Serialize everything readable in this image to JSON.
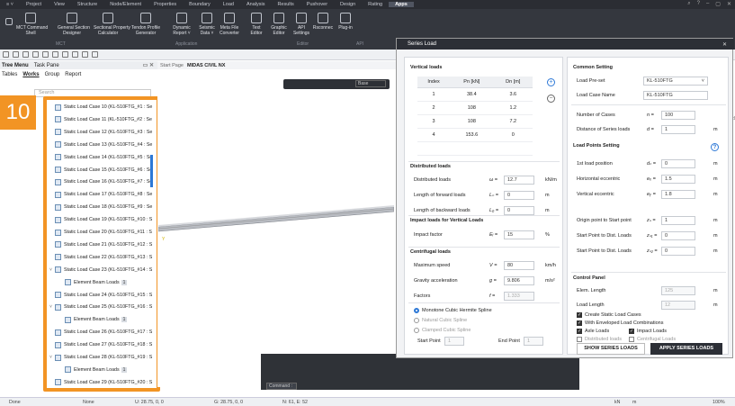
{
  "menubar": {
    "items": [
      "Project",
      "View",
      "Structure",
      "Node/Element",
      "Properties",
      "Boundary",
      "Load",
      "Analysis",
      "Results",
      "Pushover",
      "Design",
      "Rating",
      "Apps"
    ],
    "active": "Apps"
  },
  "ribbon": {
    "buttons": [
      {
        "label": "MCT Command\nShell"
      },
      {
        "label": "General Section\nDesigner"
      },
      {
        "label": "Sectional Property\nCalculator"
      },
      {
        "label": "Tendon Profile\nGenerator"
      },
      {
        "label": "Dynamic\nReport ˅"
      },
      {
        "label": "Seismic\nData ˅"
      },
      {
        "label": "Meta File\nConverter"
      },
      {
        "label": "Text\nEditor"
      },
      {
        "label": "Graphic\nEditor"
      },
      {
        "label": "API\nSettings"
      },
      {
        "label": "Rsconnec"
      },
      {
        "label": "Plug-in"
      }
    ],
    "groups": [
      "MCT",
      "Application",
      "Editor",
      "API"
    ]
  },
  "tree": {
    "header": [
      "Tree Menu",
      "Task Pane"
    ],
    "tabs": [
      "Tables",
      "Works",
      "Group",
      "Report"
    ],
    "active_tab": "Works",
    "search_placeholder": "Search",
    "rows": [
      {
        "text": "Static Load Case 10 (KL-510FTG_#1 : Se",
        "arrow": ""
      },
      {
        "text": "Static Load Case 11 (KL-510FTG_#2 : Se",
        "arrow": ""
      },
      {
        "text": "Static Load Case 12 (KL-510FTG_#3 : Se",
        "arrow": ""
      },
      {
        "text": "Static Load Case 13 (KL-510FTG_#4 : Se",
        "arrow": ""
      },
      {
        "text": "Static Load Case 14 (KL-510FTG_#5 : Se",
        "arrow": ""
      },
      {
        "text": "Static Load Case 15 (KL-510FTG_#6 : Se",
        "arrow": ""
      },
      {
        "text": "Static Load Case 16 (KL-510FTG_#7 : Se",
        "arrow": ""
      },
      {
        "text": "Static Load Case 17 (KL-510FTG_#8 : Se",
        "arrow": ""
      },
      {
        "text": "Static Load Case 18 (KL-510FTG_#9 : Se",
        "arrow": ""
      },
      {
        "text": "Static Load Case 19 (KL-510FTG_#10 : S",
        "arrow": ""
      },
      {
        "text": "Static Load Case 20 (KL-510FTG_#11 : S",
        "arrow": ""
      },
      {
        "text": "Static Load Case 21 (KL-510FTG_#12 : S",
        "arrow": ""
      },
      {
        "text": "Static Load Case 22 (KL-510FTG_#13 : S",
        "arrow": ""
      },
      {
        "text": "Static Load Case 23 (KL-510FTG_#14 : S",
        "arrow": "˅"
      },
      {
        "text": "Element Beam Loads",
        "badge": "1",
        "child": true
      },
      {
        "text": "Static Load Case 24 (KL-510FTG_#15 : S",
        "arrow": ""
      },
      {
        "text": "Static Load Case 25 (KL-510FTG_#16 : S",
        "arrow": "˅"
      },
      {
        "text": "Element Beam Loads",
        "badge": "1",
        "child": true
      },
      {
        "text": "Static Load Case 26 (KL-510FTG_#17 : S",
        "arrow": ""
      },
      {
        "text": "Static Load Case 27 (KL-510FTG_#18 : S",
        "arrow": ""
      },
      {
        "text": "Static Load Case 28 (KL-510FTG_#19 : S",
        "arrow": "˅"
      },
      {
        "text": "Element Beam Loads",
        "badge": "1",
        "child": true
      },
      {
        "text": "Static Load Case 29 (KL-510FTG_#20 : S",
        "arrow": ""
      }
    ]
  },
  "overlay_badge": "10",
  "view": {
    "tabs": [
      "Start Page",
      "MIDAS CIVIL NX"
    ],
    "combo": "Base"
  },
  "command": {
    "label": "Command :"
  },
  "status": {
    "done": "Done",
    "none": "None",
    "u": "U: 28.75, 0, 0",
    "g": "G: 28.75, 0, 0",
    "n": "N: 61, E: 52",
    "unit1": "kN",
    "unit2": "m",
    "zoom": "100%"
  },
  "dialog": {
    "title": "Series Load",
    "vertical": {
      "title": "Vertical loads",
      "headers": [
        "Index",
        "Pn [kN]",
        "Dn [m]"
      ],
      "rows": [
        [
          "1",
          "38.4",
          "3.6"
        ],
        [
          "2",
          "108",
          "1.2"
        ],
        [
          "3",
          "108",
          "7.2"
        ],
        [
          "4",
          "153.6",
          "0"
        ]
      ]
    },
    "distributed": {
      "title": "Distributed loads",
      "rows": [
        {
          "label": "Distributed loads",
          "sym": "ω =",
          "val": "12.7",
          "unit": "kN/m"
        },
        {
          "label": "Length of forward loads",
          "sym": "Lₙ =",
          "val": "0",
          "unit": "m"
        },
        {
          "label": "Length of backward loads",
          "sym": "L₀ =",
          "val": "0",
          "unit": "m"
        }
      ]
    },
    "impact": {
      "title": "Impact loads for Vertical Loads",
      "label": "Impact factor",
      "sym": "Eᵢ =",
      "val": "15",
      "unit": "%"
    },
    "centrifugal": {
      "title": "Centrifugal loads",
      "rows": [
        {
          "label": "Maximum speed",
          "sym": "V =",
          "val": "80",
          "unit": "km/h"
        },
        {
          "label": "Gravity acceleration",
          "sym": "g =",
          "val": "9.806",
          "unit": "m/s²"
        },
        {
          "label": "Factors",
          "sym": "f =",
          "val": "1.333",
          "unit": ""
        }
      ]
    },
    "spline": {
      "options": [
        "Monotone Cubic Hermite Spline",
        "Natural Cubic Spline",
        "Clamped Cubic Spline"
      ],
      "selected": 0,
      "start_label": "Start Point",
      "start_placeholder": "1",
      "end_label": "End Point",
      "end_placeholder": "1"
    },
    "common": {
      "title": "Common Setting",
      "preset_label": "Load Pre-set",
      "preset_value": "KL-510FTG",
      "name_label": "Load Case Name",
      "name_value": "KL-510FTG",
      "cases_label": "Number of Cases",
      "cases_sym": "n =",
      "cases_val": "100",
      "dist_label": "Distance of Series loads",
      "dist_sym": "d =",
      "dist_val": "1",
      "dist_unit": "m"
    },
    "points": {
      "title": "Load Points Setting",
      "help": "?",
      "rows": [
        {
          "label": "1st load position",
          "sym": "dₙ =",
          "val": "0",
          "unit": "m"
        },
        {
          "label": "Horizontal eccentric",
          "sym": "eₓ =",
          "val": "1.5",
          "unit": "m"
        },
        {
          "label": "Vertical eccentric",
          "sym": "eᵧ =",
          "val": "1.8",
          "unit": "m"
        },
        {
          "label": "Origin point to Start point",
          "sym": "zₛ =",
          "val": "1",
          "unit": "m"
        },
        {
          "label": "Start Point to Dist. Loads",
          "sym": "zₛ₁ =",
          "val": "0",
          "unit": "m"
        },
        {
          "label": "Start Point to Dist. Loads",
          "sym": "zₛ₂ =",
          "val": "0",
          "unit": "m"
        }
      ]
    },
    "control": {
      "title": "Control Panel",
      "elem_label": "Elem. Length",
      "elem_val": "125",
      "elem_unit": "m",
      "load_label": "Load Length",
      "load_val": "12",
      "load_unit": "m",
      "checks": [
        {
          "label": "Create Static Load Cases",
          "on": true
        },
        {
          "label": "With Enveloped Load Combinations",
          "on": true
        },
        {
          "label": "Axle Loads",
          "on": true
        },
        {
          "label": "Impact Loads",
          "on": true
        },
        {
          "label": "Distributed loads",
          "on": false
        },
        {
          "label": "Centrifugal Loads",
          "on": false
        }
      ],
      "show_btn": "SHOW SERIES LOADS",
      "apply_btn": "APPLY SERIES LOADS"
    }
  },
  "right_edge": {
    "items": [
      "ies",
      "ables",
      "ies"
    ]
  }
}
